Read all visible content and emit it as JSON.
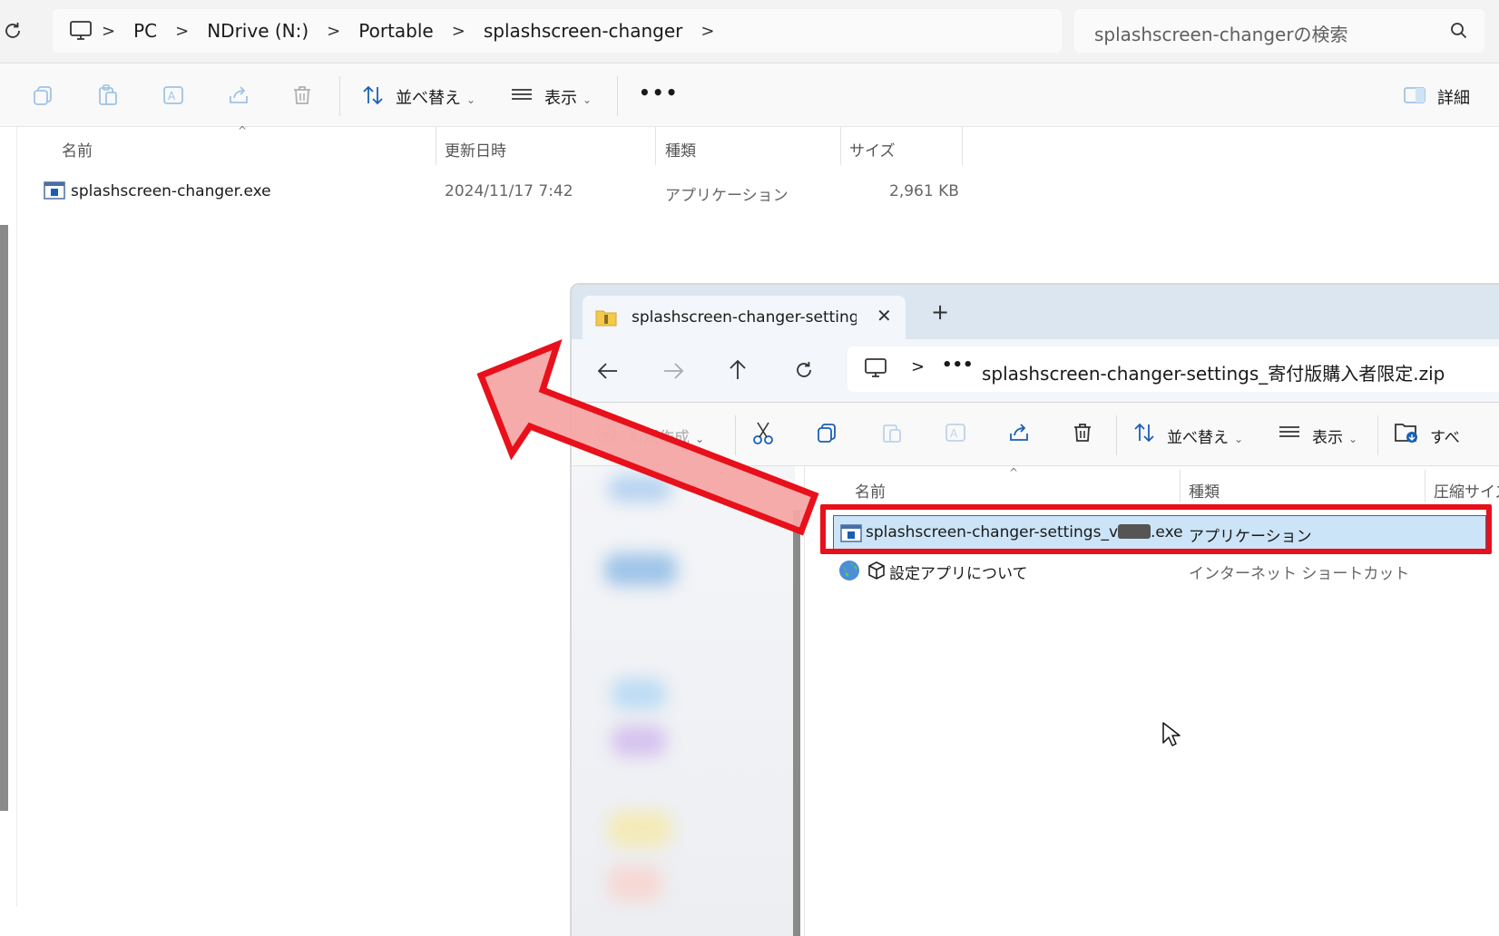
{
  "main_window": {
    "breadcrumb": [
      "PC",
      "NDrive (N:)",
      "Portable",
      "splashscreen-changer"
    ],
    "search_placeholder": "splashscreen-changerの検索",
    "toolbar": {
      "sort_label": "並べ替え",
      "view_label": "表示",
      "more_label": "•••",
      "details_label": "詳細"
    },
    "columns": [
      "名前",
      "更新日時",
      "種類",
      "サイズ"
    ],
    "files": [
      {
        "name": "splashscreen-changer.exe",
        "modified": "2024/11/17 7:42",
        "type": "アプリケーション",
        "size": "2,961 KB"
      }
    ]
  },
  "zip_window": {
    "tab_title": "splashscreen-changer-settings",
    "new_tab": "+",
    "address_text": "splashscreen-changer-settings_寄付版購入者限定.zip",
    "address_more": "•••",
    "toolbar": {
      "new_label": "新規作成",
      "sort_label": "並べ替え",
      "view_label": "表示",
      "extract_label": "すべ"
    },
    "columns": [
      "名前",
      "種類",
      "圧縮サイズ"
    ],
    "files": [
      {
        "name_prefix": "splashscreen-changer-settings_v",
        "name_suffix": ".exe",
        "type": "アプリケーション",
        "selected": true
      },
      {
        "name": "設定アプリについて",
        "type": "インターネット ショートカット",
        "selected": false
      }
    ]
  },
  "colors": {
    "accent_red": "#e8101a",
    "arrow_fill": "#f6a6a6",
    "selection_bg": "#cce4f7",
    "selection_border": "#1a6fc4"
  }
}
